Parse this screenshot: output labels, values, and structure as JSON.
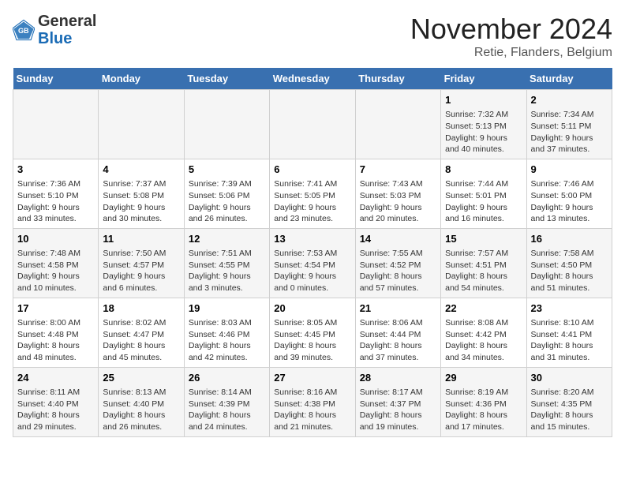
{
  "header": {
    "logo_general": "General",
    "logo_blue": "Blue",
    "month_title": "November 2024",
    "location": "Retie, Flanders, Belgium"
  },
  "weekdays": [
    "Sunday",
    "Monday",
    "Tuesday",
    "Wednesday",
    "Thursday",
    "Friday",
    "Saturday"
  ],
  "weeks": [
    [
      {
        "day": "",
        "info": ""
      },
      {
        "day": "",
        "info": ""
      },
      {
        "day": "",
        "info": ""
      },
      {
        "day": "",
        "info": ""
      },
      {
        "day": "",
        "info": ""
      },
      {
        "day": "1",
        "info": "Sunrise: 7:32 AM\nSunset: 5:13 PM\nDaylight: 9 hours and 40 minutes."
      },
      {
        "day": "2",
        "info": "Sunrise: 7:34 AM\nSunset: 5:11 PM\nDaylight: 9 hours and 37 minutes."
      }
    ],
    [
      {
        "day": "3",
        "info": "Sunrise: 7:36 AM\nSunset: 5:10 PM\nDaylight: 9 hours and 33 minutes."
      },
      {
        "day": "4",
        "info": "Sunrise: 7:37 AM\nSunset: 5:08 PM\nDaylight: 9 hours and 30 minutes."
      },
      {
        "day": "5",
        "info": "Sunrise: 7:39 AM\nSunset: 5:06 PM\nDaylight: 9 hours and 26 minutes."
      },
      {
        "day": "6",
        "info": "Sunrise: 7:41 AM\nSunset: 5:05 PM\nDaylight: 9 hours and 23 minutes."
      },
      {
        "day": "7",
        "info": "Sunrise: 7:43 AM\nSunset: 5:03 PM\nDaylight: 9 hours and 20 minutes."
      },
      {
        "day": "8",
        "info": "Sunrise: 7:44 AM\nSunset: 5:01 PM\nDaylight: 9 hours and 16 minutes."
      },
      {
        "day": "9",
        "info": "Sunrise: 7:46 AM\nSunset: 5:00 PM\nDaylight: 9 hours and 13 minutes."
      }
    ],
    [
      {
        "day": "10",
        "info": "Sunrise: 7:48 AM\nSunset: 4:58 PM\nDaylight: 9 hours and 10 minutes."
      },
      {
        "day": "11",
        "info": "Sunrise: 7:50 AM\nSunset: 4:57 PM\nDaylight: 9 hours and 6 minutes."
      },
      {
        "day": "12",
        "info": "Sunrise: 7:51 AM\nSunset: 4:55 PM\nDaylight: 9 hours and 3 minutes."
      },
      {
        "day": "13",
        "info": "Sunrise: 7:53 AM\nSunset: 4:54 PM\nDaylight: 9 hours and 0 minutes."
      },
      {
        "day": "14",
        "info": "Sunrise: 7:55 AM\nSunset: 4:52 PM\nDaylight: 8 hours and 57 minutes."
      },
      {
        "day": "15",
        "info": "Sunrise: 7:57 AM\nSunset: 4:51 PM\nDaylight: 8 hours and 54 minutes."
      },
      {
        "day": "16",
        "info": "Sunrise: 7:58 AM\nSunset: 4:50 PM\nDaylight: 8 hours and 51 minutes."
      }
    ],
    [
      {
        "day": "17",
        "info": "Sunrise: 8:00 AM\nSunset: 4:48 PM\nDaylight: 8 hours and 48 minutes."
      },
      {
        "day": "18",
        "info": "Sunrise: 8:02 AM\nSunset: 4:47 PM\nDaylight: 8 hours and 45 minutes."
      },
      {
        "day": "19",
        "info": "Sunrise: 8:03 AM\nSunset: 4:46 PM\nDaylight: 8 hours and 42 minutes."
      },
      {
        "day": "20",
        "info": "Sunrise: 8:05 AM\nSunset: 4:45 PM\nDaylight: 8 hours and 39 minutes."
      },
      {
        "day": "21",
        "info": "Sunrise: 8:06 AM\nSunset: 4:44 PM\nDaylight: 8 hours and 37 minutes."
      },
      {
        "day": "22",
        "info": "Sunrise: 8:08 AM\nSunset: 4:42 PM\nDaylight: 8 hours and 34 minutes."
      },
      {
        "day": "23",
        "info": "Sunrise: 8:10 AM\nSunset: 4:41 PM\nDaylight: 8 hours and 31 minutes."
      }
    ],
    [
      {
        "day": "24",
        "info": "Sunrise: 8:11 AM\nSunset: 4:40 PM\nDaylight: 8 hours and 29 minutes."
      },
      {
        "day": "25",
        "info": "Sunrise: 8:13 AM\nSunset: 4:40 PM\nDaylight: 8 hours and 26 minutes."
      },
      {
        "day": "26",
        "info": "Sunrise: 8:14 AM\nSunset: 4:39 PM\nDaylight: 8 hours and 24 minutes."
      },
      {
        "day": "27",
        "info": "Sunrise: 8:16 AM\nSunset: 4:38 PM\nDaylight: 8 hours and 21 minutes."
      },
      {
        "day": "28",
        "info": "Sunrise: 8:17 AM\nSunset: 4:37 PM\nDaylight: 8 hours and 19 minutes."
      },
      {
        "day": "29",
        "info": "Sunrise: 8:19 AM\nSunset: 4:36 PM\nDaylight: 8 hours and 17 minutes."
      },
      {
        "day": "30",
        "info": "Sunrise: 8:20 AM\nSunset: 4:35 PM\nDaylight: 8 hours and 15 minutes."
      }
    ]
  ]
}
